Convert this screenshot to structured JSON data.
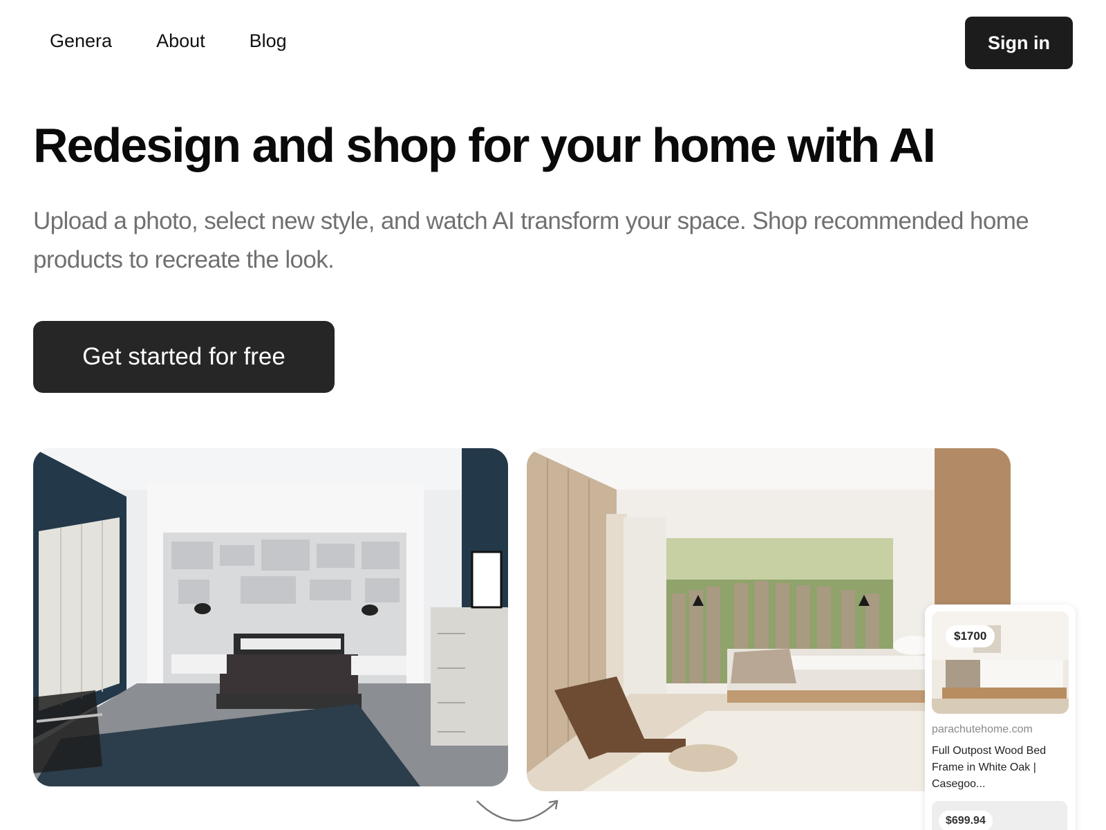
{
  "nav": {
    "links": [
      {
        "label": "Genera"
      },
      {
        "label": "About"
      },
      {
        "label": "Blog"
      }
    ],
    "sign_in_label": "Sign in"
  },
  "hero": {
    "title": "Redesign and shop for your home with AI",
    "subtitle": "Upload a photo, select new style, and watch AI transform your space. Shop recommended home products to recreate the look.",
    "cta_label": "Get started for free"
  },
  "product": {
    "price_badge": "$1700",
    "domain": "parachutehome.com",
    "name": "Full Outpost Wood Bed Frame in White Oak | Casegoo...",
    "second_price": "$699.94"
  },
  "colors": {
    "button_bg": "#1c1c1c",
    "subtitle_text": "#707070",
    "page_bg": "#ffffff"
  }
}
